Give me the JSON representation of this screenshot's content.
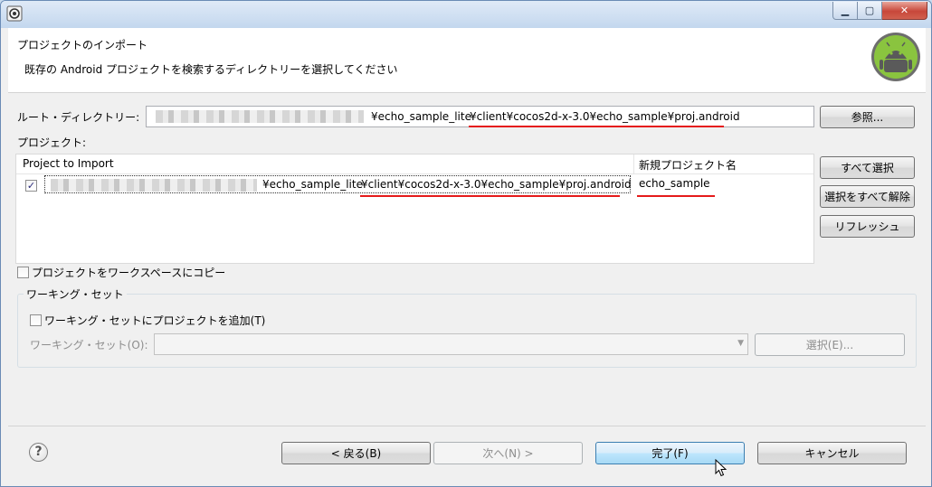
{
  "titlebar": {
    "icons": {
      "app": "eclipse-icon",
      "minimize": "minimize-icon",
      "maximize": "maximize-icon",
      "close": "close-icon"
    }
  },
  "header": {
    "title": "プロジェクトのインポート",
    "description": "既存の Android プロジェクトを検索するディレクトリーを選択してください",
    "logo": "android-logo"
  },
  "root_dir": {
    "label": "ルート・ディレクトリー:",
    "path_prefix": "¥echo_sample_lite",
    "path_highlight": "¥client¥cocos2d-x-3.0¥echo_sample¥proj.android",
    "browse_label": "参照..."
  },
  "projects": {
    "label": "プロジェクト:",
    "columns": [
      "Project to Import",
      "新規プロジェクト名"
    ],
    "rows": [
      {
        "checked": true,
        "path_prefix": "¥echo_sample_lite",
        "path_highlight": "¥client¥cocos2d-x-3.0¥echo_sample¥proj.android",
        "new_name": "echo_sample"
      }
    ],
    "select_all_label": "すべて選択",
    "deselect_all_label": "選択をすべて解除",
    "refresh_label": "リフレッシュ"
  },
  "copy_option": {
    "label": "プロジェクトをワークスペースにコピー",
    "checked": false
  },
  "working_set": {
    "group_title": "ワーキング・セット",
    "add_label": "ワーキング・セットにプロジェクトを追加(T)",
    "add_checked": false,
    "set_label": "ワーキング・セット(O):",
    "set_value": "",
    "select_label": "選択(E)..."
  },
  "footer": {
    "back_label": "< 戻る(B)",
    "next_label": "次へ(N) >",
    "finish_label": "完了(F)",
    "cancel_label": "キャンセル",
    "help_icon": "help-icon"
  },
  "colors": {
    "highlight_underline": "#e51a1a",
    "titlebar": "#c3d7ee",
    "default_button": "#bee6fd"
  }
}
